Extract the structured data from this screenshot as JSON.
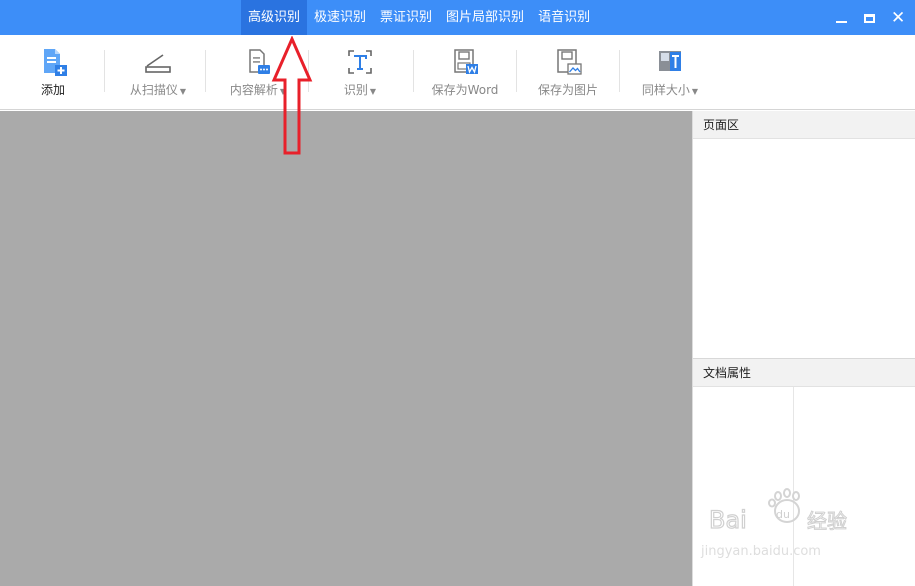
{
  "title_bar": {
    "tabs": [
      {
        "label": "高级识别",
        "active": true
      },
      {
        "label": "极速识别",
        "active": false
      },
      {
        "label": "票证识别",
        "active": false
      },
      {
        "label": "图片局部识别",
        "active": false
      },
      {
        "label": "语音识别",
        "active": false
      }
    ],
    "window_controls": [
      "minimize-icon",
      "maximize-icon",
      "close-icon"
    ]
  },
  "toolbar": {
    "add_label": "添加",
    "scanner_label": "从扫描仪",
    "content_parse_label": "内容解析",
    "recognize_label": "识别",
    "save_word_label": "保存为Word",
    "save_image_label": "保存为图片",
    "same_size_label": "同样大小",
    "dropdown_caret": "▼"
  },
  "right_panel": {
    "page_area_title": "页面区",
    "doc_props_title": "文档属性"
  },
  "watermark": {
    "logo_text": "Bai du 经验",
    "url": "jingyan.baidu.com"
  },
  "colors": {
    "titlebar_blue": "#3d8ef8",
    "active_tab": "#2a73e0",
    "canvas_gray": "#aaaaaa",
    "annotation_red": "#e8202a"
  }
}
